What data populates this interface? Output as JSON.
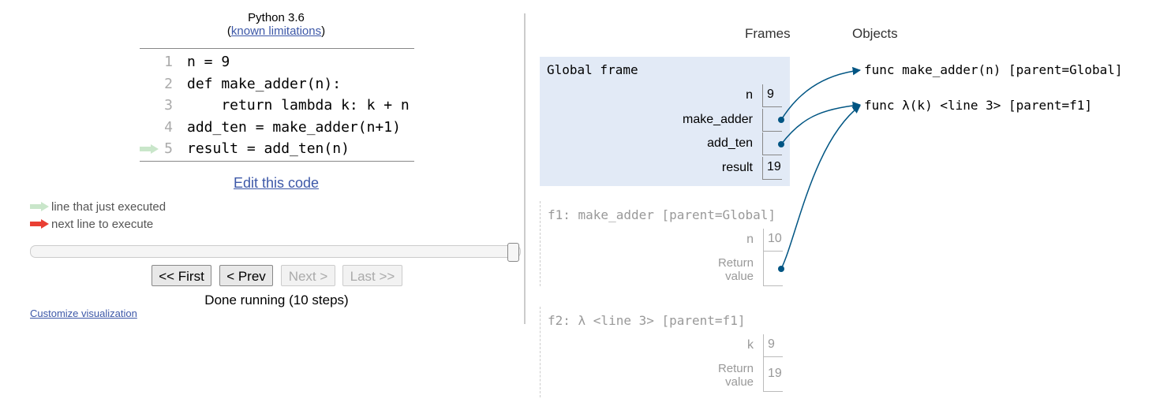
{
  "header": {
    "language": "Python 3.6",
    "limitations_prefix": "(",
    "limitations_link": "known limitations",
    "limitations_suffix": ")"
  },
  "code": {
    "lines": [
      {
        "num": "1",
        "text": "n = 9"
      },
      {
        "num": "2",
        "text": "def make_adder(n):"
      },
      {
        "num": "3",
        "text": "    return lambda k: k + n"
      },
      {
        "num": "4",
        "text": "add_ten = make_adder(n+1)"
      },
      {
        "num": "5",
        "text": "result = add_ten(n)"
      }
    ],
    "current_line": 5
  },
  "edit_link": "Edit this code",
  "legend": {
    "executed": "line that just executed",
    "next": "next line to execute",
    "executed_color": "#c9e6ca",
    "next_color": "#e93f34"
  },
  "nav": {
    "first": "<< First",
    "prev": "< Prev",
    "next": "Next >",
    "last": "Last >>",
    "status": "Done running (10 steps)",
    "progress": 1.0
  },
  "customize_link": "Customize visualization",
  "viz": {
    "frames_header": "Frames",
    "objects_header": "Objects",
    "global_frame": {
      "title": "Global frame",
      "vars": [
        {
          "name": "n",
          "value": "9"
        },
        {
          "name": "make_adder",
          "value": ""
        },
        {
          "name": "add_ten",
          "value": ""
        },
        {
          "name": "result",
          "value": "19"
        }
      ]
    },
    "f1": {
      "title": "f1: make_adder [parent=Global]",
      "var_name": "n",
      "var_value": "10",
      "return_label_1": "Return",
      "return_label_2": "value"
    },
    "f2": {
      "title": "f2: λ <line 3> [parent=f1]",
      "var_name": "k",
      "var_value": "9",
      "return_label_1": "Return",
      "return_label_2": "value",
      "return_value": "19"
    },
    "objects": [
      {
        "text": "func make_adder(n) [parent=Global]"
      },
      {
        "text": "func λ(k) <line 3> [parent=f1]"
      }
    ],
    "pointer_color": "#005583",
    "frame_bg": "#e2eaf6"
  }
}
